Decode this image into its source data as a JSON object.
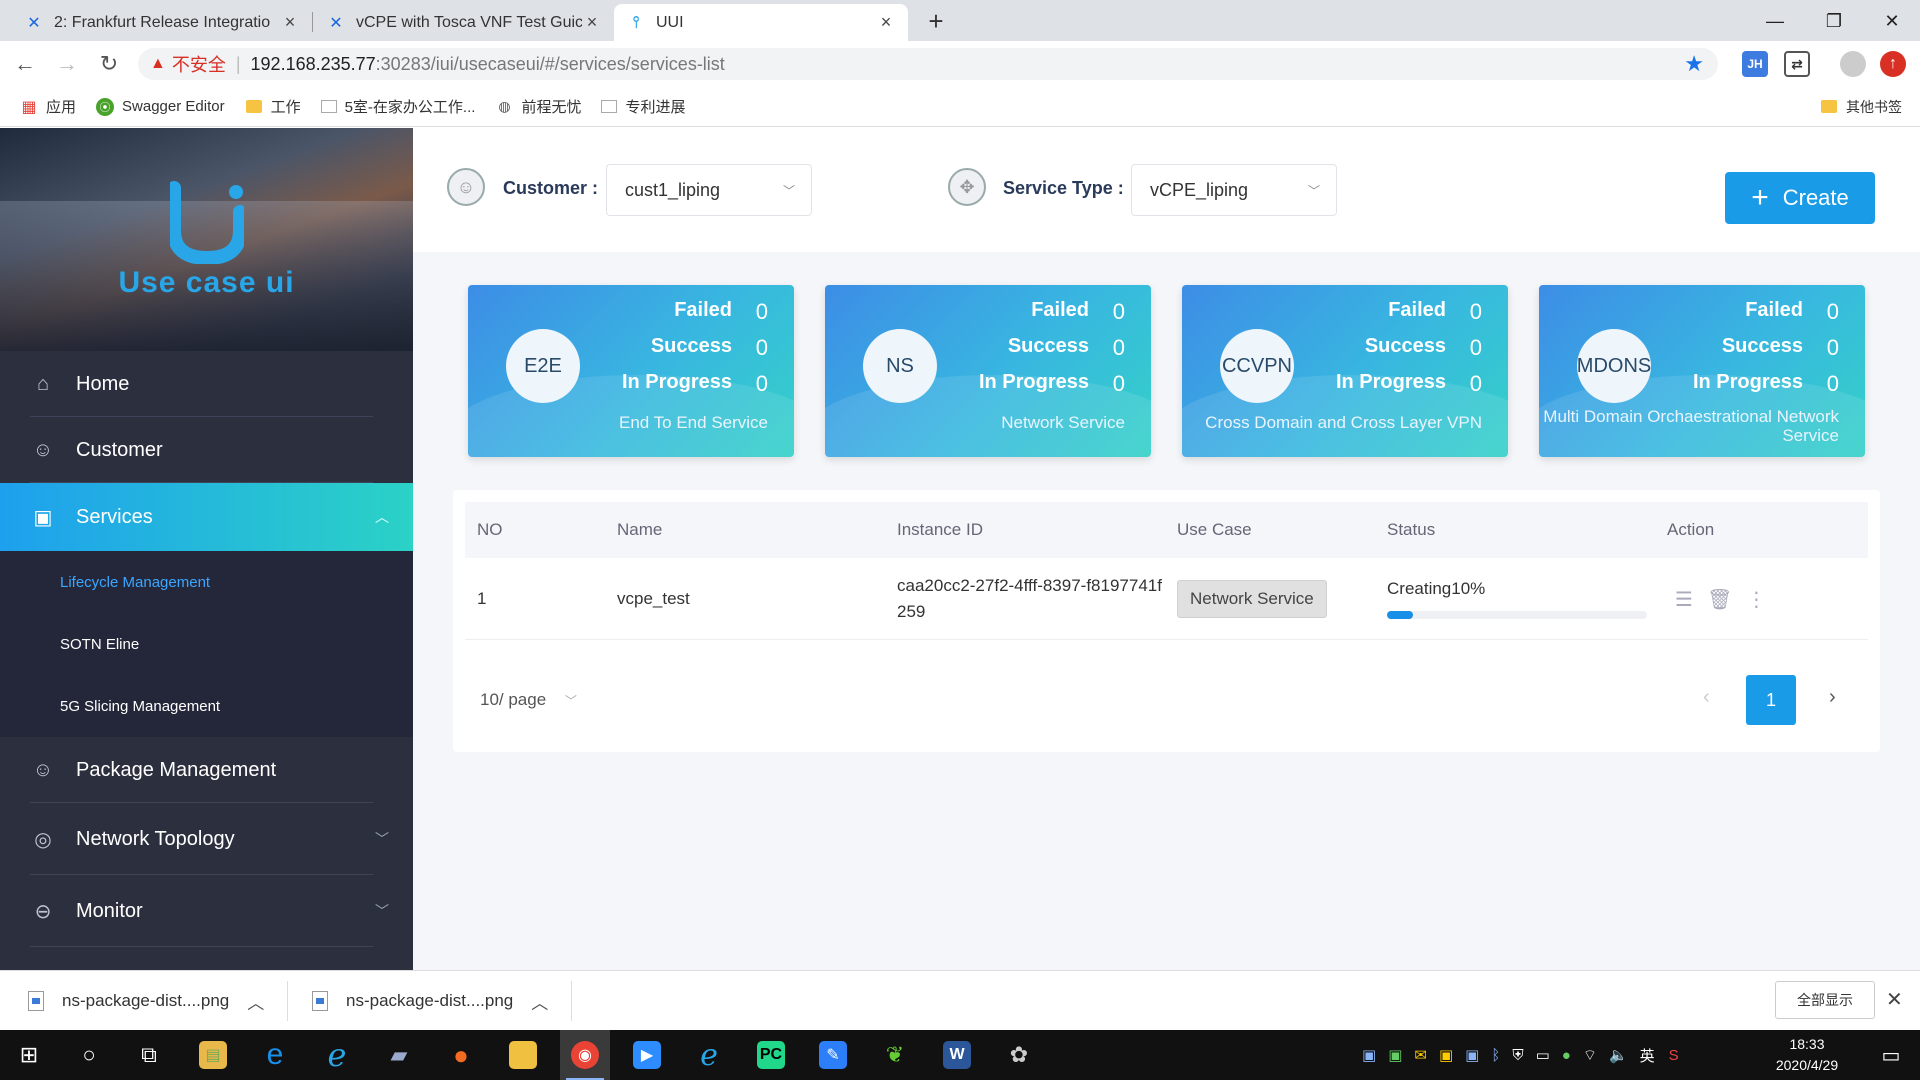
{
  "browser": {
    "tabs": [
      {
        "title": "2: Frankfurt Release Integratio",
        "icon": "confluence-icon"
      },
      {
        "title": "vCPE with Tosca VNF Test Guic",
        "icon": "confluence-icon"
      },
      {
        "title": "UUI",
        "icon": "uui-icon"
      }
    ],
    "address": {
      "insecure_label": "不安全",
      "host": "192.168.235.77",
      "path": ":30283/iui/usecaseui/#/services/services-list"
    },
    "extensions": [
      "JH",
      "ext-2",
      "profile",
      "update"
    ],
    "bookmarks": [
      {
        "label": "应用",
        "icon": "apps-icon"
      },
      {
        "label": "Swagger Editor",
        "icon": "swagger-icon"
      },
      {
        "label": "工作",
        "icon": "folder-icon"
      },
      {
        "label": "5室-在家办公工作...",
        "icon": "page-icon"
      },
      {
        "label": "前程无忧",
        "icon": "globe-icon"
      },
      {
        "label": "专利进展",
        "icon": "page-icon"
      }
    ],
    "other_bookmarks": "其他书签"
  },
  "sidebar": {
    "logo_text": "Use case ui",
    "items": [
      {
        "label": "Home",
        "icon": "home-icon"
      },
      {
        "label": "Customer",
        "icon": "customer-icon"
      },
      {
        "label": "Services",
        "icon": "services-icon",
        "active": true
      },
      {
        "label": "Package Management",
        "icon": "package-icon"
      },
      {
        "label": "Network Topology",
        "icon": "topology-icon"
      },
      {
        "label": "Monitor",
        "icon": "monitor-icon"
      }
    ],
    "sub_items": [
      {
        "label": "Lifecycle Management",
        "active": true
      },
      {
        "label": "SOTN Eline"
      },
      {
        "label": "5G Slicing Management"
      }
    ]
  },
  "filters": {
    "customer_label": "Customer :",
    "customer_value": "cust1_liping",
    "service_type_label": "Service Type :",
    "service_type_value": "vCPE_liping",
    "create_label": "Create"
  },
  "stats": [
    {
      "abbr": "E2E",
      "failed": 0,
      "success": 0,
      "in_progress": 0,
      "desc": "End To End Service"
    },
    {
      "abbr": "NS",
      "failed": 0,
      "success": 0,
      "in_progress": 0,
      "desc": "Network Service"
    },
    {
      "abbr": "CCVPN",
      "failed": 0,
      "success": 0,
      "in_progress": 0,
      "desc": "Cross Domain and Cross Layer VPN"
    },
    {
      "abbr": "MDONS",
      "failed": 0,
      "success": 0,
      "in_progress": 0,
      "desc": "Multi Domain Orchaestrational Network Service"
    }
  ],
  "stat_labels": {
    "failed": "Failed",
    "success": "Success",
    "in_progress": "In Progress"
  },
  "table": {
    "headers": [
      "NO",
      "Name",
      "Instance ID",
      "Use Case",
      "Status",
      "Action"
    ],
    "rows": [
      {
        "no": "1",
        "name": "vcpe_test",
        "instance_id": "caa20cc2-27f2-4fff-8397-f8197741f259",
        "use_case": "Network Service",
        "status": "Creating10%",
        "progress": 10
      }
    ]
  },
  "pagination": {
    "page_size": "10/ page",
    "current": "1"
  },
  "downloads": [
    {
      "name": "ns-package-dist....png"
    },
    {
      "name": "ns-package-dist....png"
    }
  ],
  "show_all": "全部显示",
  "clock": {
    "time": "18:33",
    "date": "2020/4/29"
  },
  "ime": "英"
}
